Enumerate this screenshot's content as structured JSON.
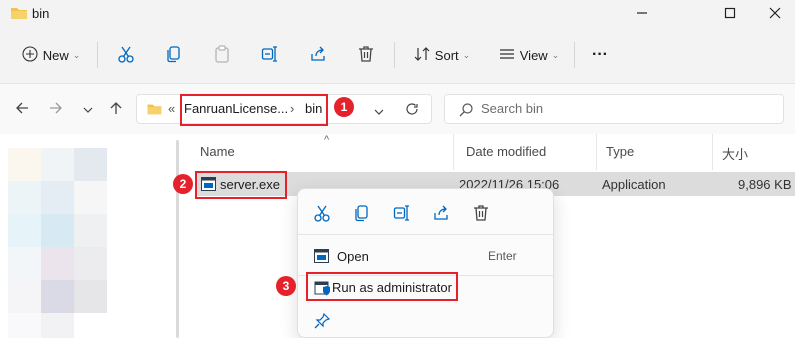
{
  "window": {
    "title": "bin"
  },
  "toolbar": {
    "new_label": "New",
    "sort_label": "Sort",
    "view_label": "View",
    "more_label": "···"
  },
  "address": {
    "prefix": "«",
    "segments": [
      "FanruanLicense...",
      "bin"
    ],
    "separator": "›"
  },
  "search": {
    "placeholder": "Search bin"
  },
  "columns": {
    "name": "Name",
    "date": "Date modified",
    "type": "Type",
    "size": "大小"
  },
  "files": [
    {
      "name": "server.exe",
      "date": "2022/11/26 15:06",
      "type": "Application",
      "size": "9,896 KB"
    }
  ],
  "context_menu": {
    "items": [
      {
        "label": "Open",
        "shortcut": "Enter"
      },
      {
        "label": "Run as administrator",
        "shortcut": ""
      }
    ]
  },
  "annotations": [
    "1",
    "2",
    "3"
  ],
  "colors": {
    "accent": "#0067c0",
    "highlight": "#e5222c",
    "folder": "#f2c14e",
    "selected_row": "#dcdcdc"
  },
  "icons": [
    "folder-icon",
    "minimize-icon",
    "maximize-icon",
    "close-icon",
    "plus-icon",
    "cut-icon",
    "copy-icon",
    "paste-icon",
    "rename-icon",
    "share-icon",
    "delete-icon",
    "sort-icon",
    "view-icon",
    "back-icon",
    "forward-icon",
    "recent-icon",
    "up-icon",
    "refresh-icon",
    "search-icon",
    "exe-icon",
    "pin-icon",
    "shield-icon"
  ]
}
